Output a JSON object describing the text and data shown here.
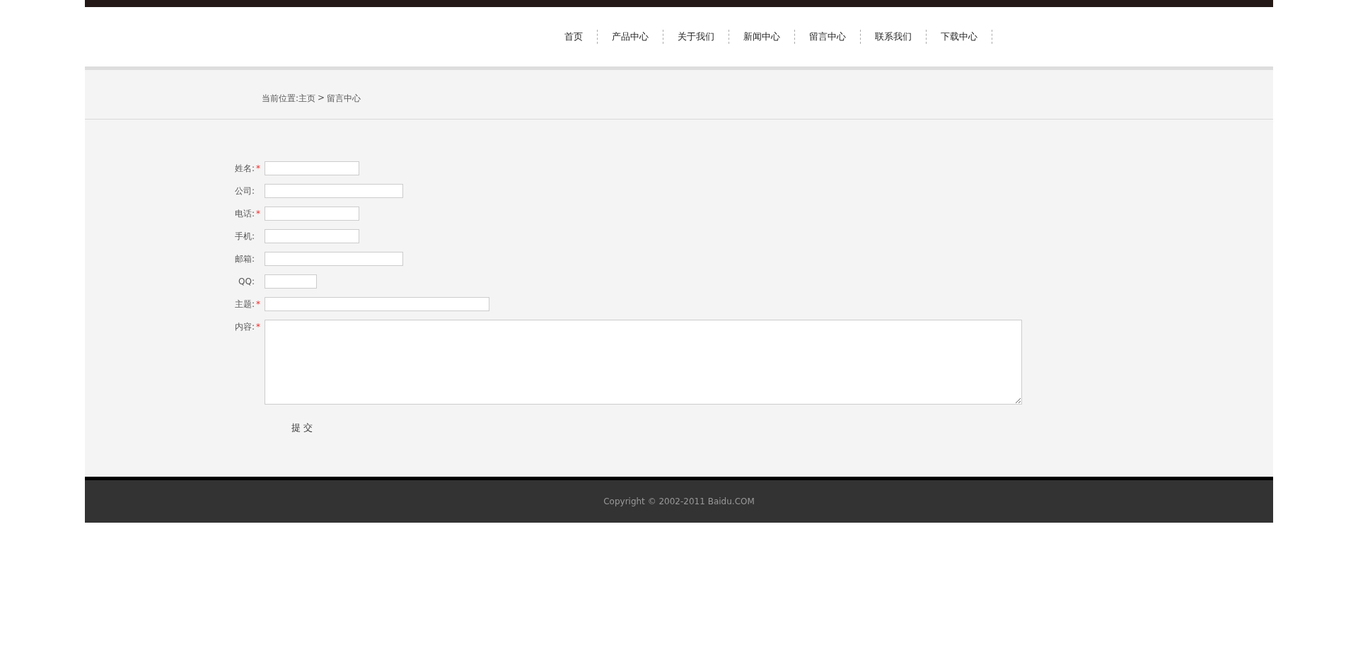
{
  "nav": [
    {
      "label": "首页"
    },
    {
      "label": "产品中心"
    },
    {
      "label": "关于我们"
    },
    {
      "label": "新闻中心"
    },
    {
      "label": "留言中心"
    },
    {
      "label": "联系我们"
    },
    {
      "label": "下载中心"
    }
  ],
  "breadcrumb": {
    "prefix": "当前位置:",
    "home": "主页",
    "separator": ">",
    "current": "留言中心"
  },
  "form": {
    "fields": [
      {
        "label": "姓名:",
        "required": true,
        "kind": "short"
      },
      {
        "label": "公司:",
        "required": false,
        "kind": "medium"
      },
      {
        "label": "电话:",
        "required": true,
        "kind": "short"
      },
      {
        "label": "手机:",
        "required": false,
        "kind": "short"
      },
      {
        "label": "邮箱:",
        "required": false,
        "kind": "medium"
      },
      {
        "label": "QQ:",
        "required": false,
        "kind": "tiny"
      },
      {
        "label": "主题:",
        "required": true,
        "kind": "long"
      },
      {
        "label": "内容:",
        "required": true,
        "kind": "multiline"
      }
    ],
    "required_mark": "*",
    "submit": "提 交"
  },
  "footer": {
    "copyright": "Copyright © 2002-2011 Baidu.COM"
  }
}
